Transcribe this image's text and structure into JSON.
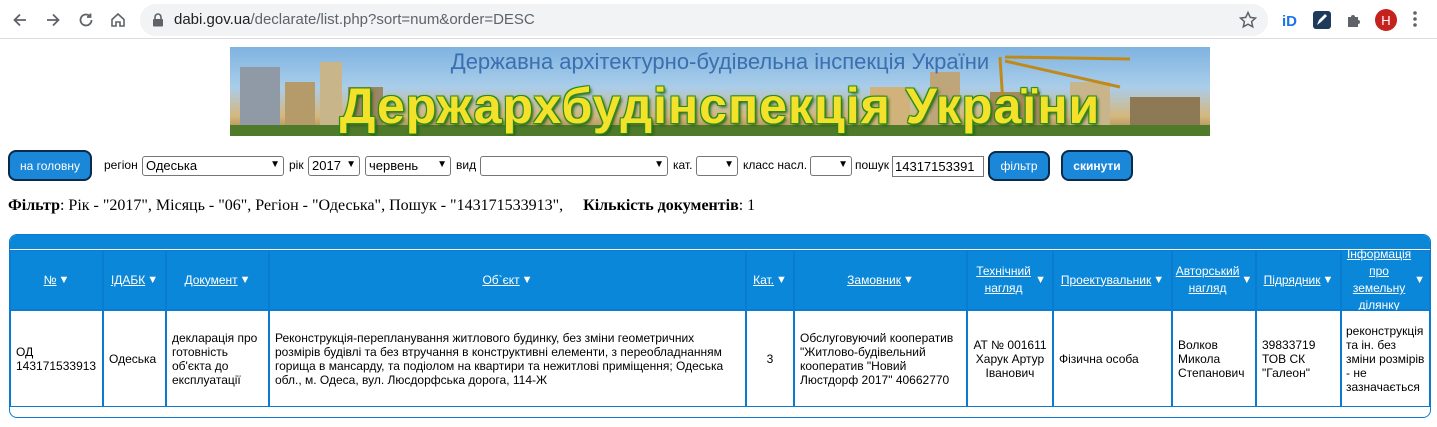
{
  "browser": {
    "url_host": "dabi.gov.ua",
    "url_path": "/declarate/list.php?sort=num&order=DESC",
    "profile_initial": "H"
  },
  "banner": {
    "subtitle": "Державна архітектурно-будівельна інспекція України",
    "title": "Держархбудінспекція України"
  },
  "filters": {
    "home_button": "на головну",
    "region_label": "регіон",
    "region_value": "Одеська",
    "year_label": "рік",
    "year_value": "2017",
    "month_value": "червень",
    "type_label": "вид",
    "type_value": "",
    "cat_label": "кат.",
    "cat_value": "",
    "class_label": "класс насл.",
    "class_value": "",
    "search_label": "пошук",
    "search_value": "14317153391",
    "filter_button": "фільтр",
    "reset_button": "скинути"
  },
  "filter_summary": {
    "filter_label": "Фільтр",
    "filter_text": ": Рік - \"2017\", Місяць - \"06\", Регіон - \"Одеська\", Пошук - \"143171533913\",",
    "count_label": "Кількість документів",
    "count_text": ": 1"
  },
  "table": {
    "headers": [
      "№",
      "ІДАБК",
      "Документ",
      "Об`єкт",
      "Кат.",
      "Замовник",
      "Технічний нагляд",
      "Проектувальник",
      "Авторський нагляд",
      "Підрядник",
      "Інформація про земельну ділянку"
    ],
    "rows": [
      [
        "ОД 143171533913",
        "Одеська",
        "декларація про готовність об'єкта до експлуатації",
        "Реконструкція-перепланування житлового будинку, без зміни геометричних розмірів будівлі та без втручання в конструктивні елементи, з переобладнанням горища в мансарду, та подіолом на квартири та нежитлові приміщення; Одеська обл., м. Одеса, вул. Люсдорфська дорога, 114-Ж",
        "3",
        "Обслуговуючий кооператив \"Житлово-будівельний кооператив \"Новий Люстдорф 2017\" 40662770",
        "АТ № 001611 Харук Артур Іванович",
        "Фізична особа",
        "Волков Микола Степанович",
        "39833719 ТОВ СК \"Галеон\"",
        "реконструкція та ін. без зміни розмірів - не зазначається"
      ]
    ]
  },
  "colors": {
    "accent": "#0a87d8",
    "button_border": "#0a2a4a",
    "banner_title": "#f3e12a"
  },
  "icons": [
    "back-arrow-icon",
    "forward-arrow-icon",
    "reload-icon",
    "home-icon",
    "lock-icon",
    "star-icon",
    "id-extension-icon",
    "pen-extension-icon",
    "puzzle-icon",
    "kebab-menu-icon",
    "sort-arrow-icon"
  ]
}
